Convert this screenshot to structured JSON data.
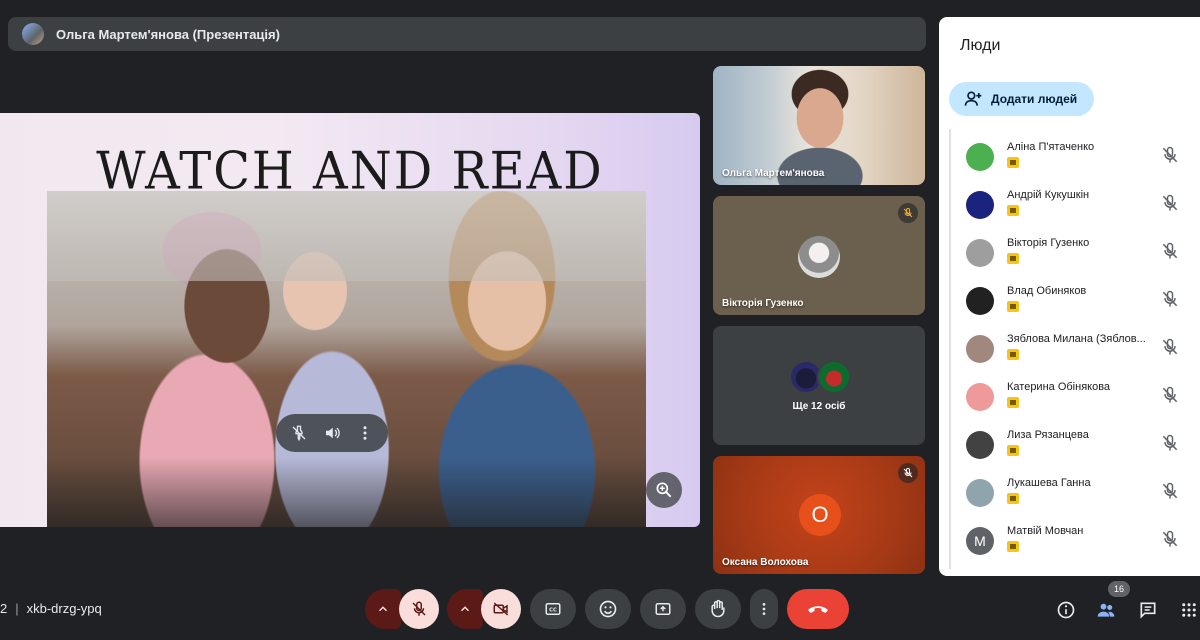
{
  "presenter": {
    "label": "Ольга Мартем'янова (Презентація)"
  },
  "slide": {
    "title": "WATCH AND READ"
  },
  "tiles": [
    {
      "name": "Ольга Мартем'янова",
      "muted": false
    },
    {
      "name": "Вікторія Гузенко",
      "muted": true
    },
    {
      "more_label": "Ще 12 осіб"
    },
    {
      "name": "Оксана Волохова",
      "initial": "О",
      "muted": true
    }
  ],
  "people_panel": {
    "title": "Люди",
    "add_label": "Додати людей",
    "people": [
      {
        "name": "Аліна П'ятаченко",
        "avatar_color": "#4caf50"
      },
      {
        "name": "Андрій Кукушкін",
        "avatar_color": "#1a237e"
      },
      {
        "name": "Вікторія Гузенко",
        "avatar_color": "#9e9e9e"
      },
      {
        "name": "Влад Обиняков",
        "avatar_color": "#212121"
      },
      {
        "name": "Зяблова Милана (Зяблов...",
        "avatar_color": "#a1887f"
      },
      {
        "name": "Катерина Обінякова",
        "avatar_color": "#ef9a9a"
      },
      {
        "name": "Лиза Рязанцева",
        "avatar_color": "#424242"
      },
      {
        "name": "Лукашева Ганна",
        "avatar_color": "#90a4ae"
      },
      {
        "name": "Матвій Мовчан",
        "initial": "М",
        "avatar_color": "#5f6368"
      }
    ]
  },
  "bottom_bar": {
    "meeting_prefix": "2",
    "meeting_code": "xkb-drzg-ypq",
    "people_count": "16",
    "colors": {
      "mic_off_bg": "#f9dedc",
      "end_call": "#ea4335",
      "control_bg": "#3c4043"
    }
  }
}
